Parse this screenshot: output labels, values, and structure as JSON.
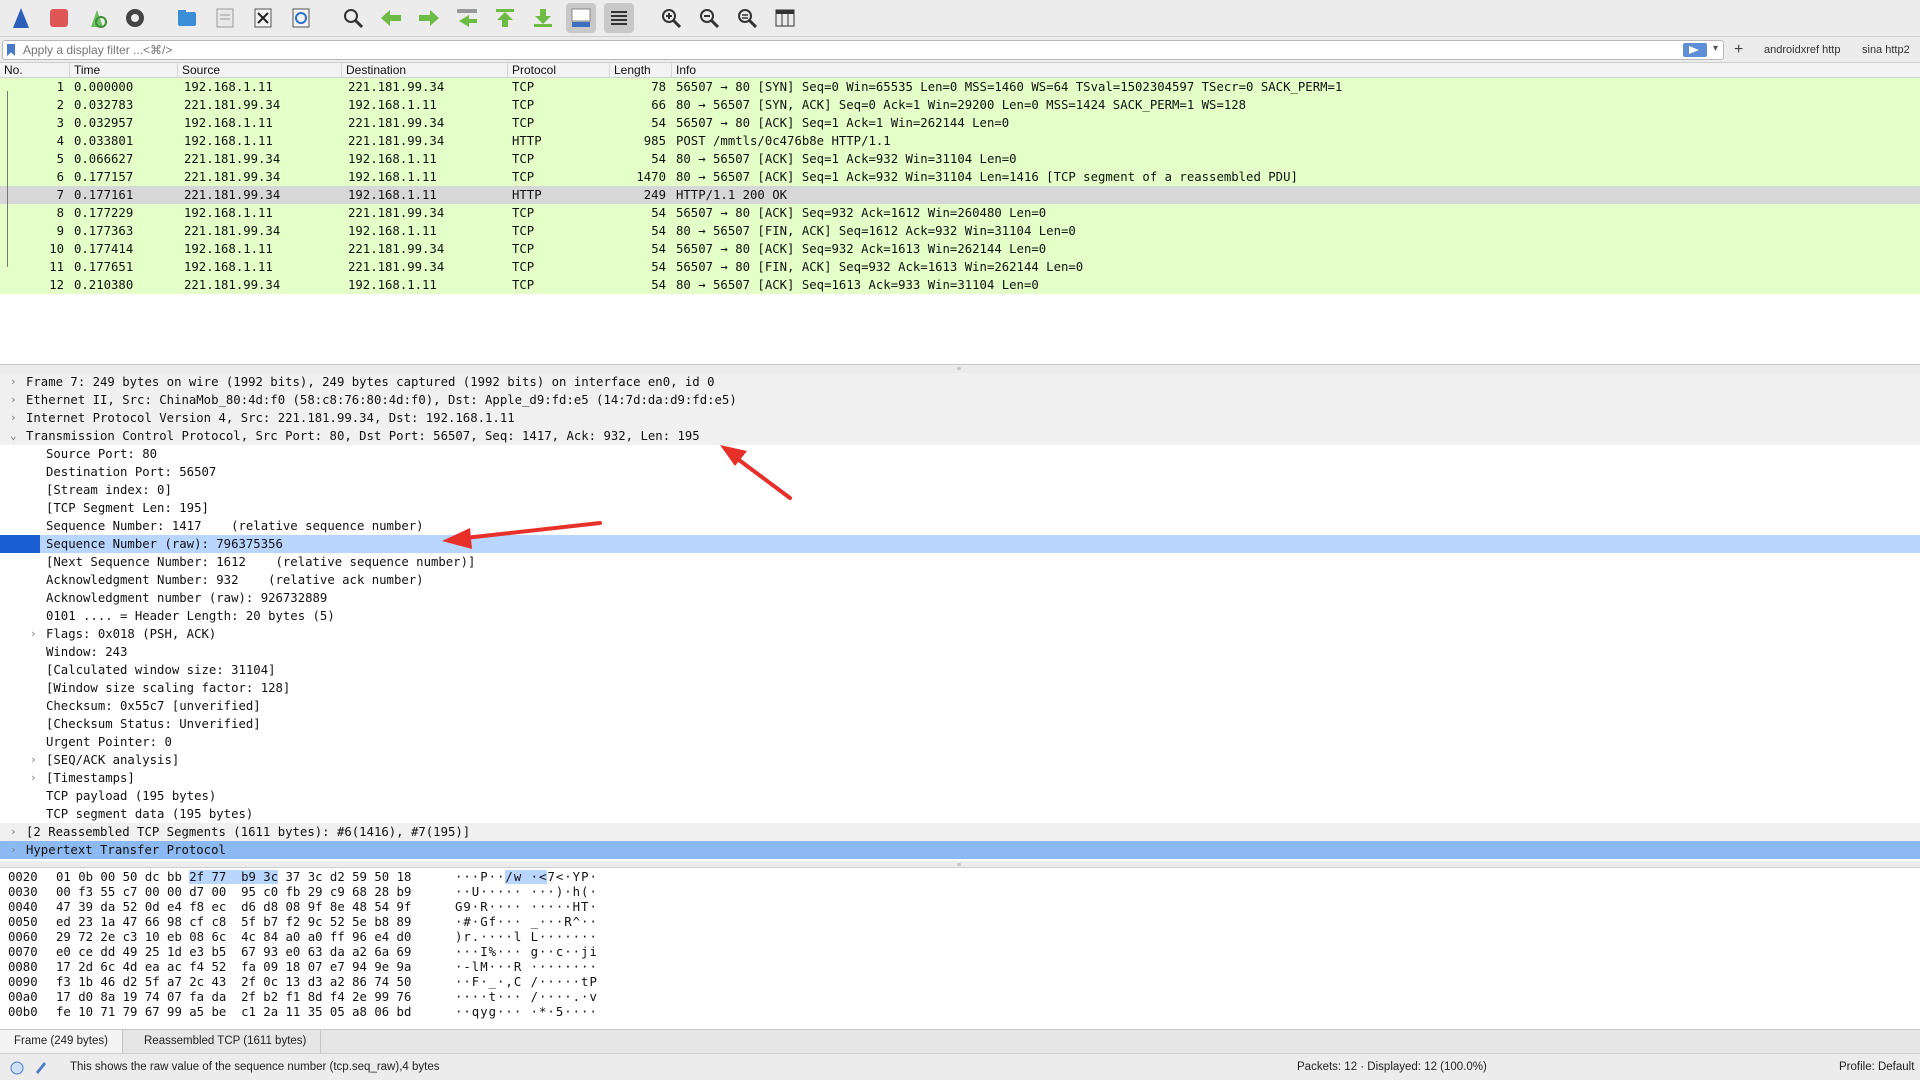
{
  "toolbar": {
    "buttons": [
      "shark-fin-start-icon",
      "stop-capture-icon",
      "restart-capture-icon",
      "capture-options-icon",
      "open-file-icon",
      "save-file-icon",
      "close-file-icon",
      "reload-file-icon",
      "find-packet-icon",
      "go-back-icon",
      "go-forward-icon",
      "go-to-packet-icon",
      "first-packet-icon",
      "last-packet-icon",
      "autoscroll-icon",
      "colorize-icon",
      "zoom-in-icon",
      "zoom-out-icon",
      "zoom-normal-icon",
      "resize-columns-icon"
    ]
  },
  "filter": {
    "placeholder": "Apply a display filter ...<⌘/>",
    "add_label": "+",
    "buttons": [
      "androidxref http",
      "sina http2"
    ]
  },
  "packet_list": {
    "columns": [
      "No.",
      "Time",
      "Source",
      "Destination",
      "Protocol",
      "Length",
      "Info"
    ],
    "rows": [
      {
        "no": "1",
        "time": "0.000000",
        "src": "192.168.1.11",
        "dst": "221.181.99.34",
        "proto": "TCP",
        "len": "78",
        "info": "56507 → 80 [SYN] Seq=0 Win=65535 Len=0 MSS=1460 WS=64 TSval=1502304597 TSecr=0 SACK_PERM=1"
      },
      {
        "no": "2",
        "time": "0.032783",
        "src": "221.181.99.34",
        "dst": "192.168.1.11",
        "proto": "TCP",
        "len": "66",
        "info": "80 → 56507 [SYN, ACK] Seq=0 Ack=1 Win=29200 Len=0 MSS=1424 SACK_PERM=1 WS=128"
      },
      {
        "no": "3",
        "time": "0.032957",
        "src": "192.168.1.11",
        "dst": "221.181.99.34",
        "proto": "TCP",
        "len": "54",
        "info": "56507 → 80 [ACK] Seq=1 Ack=1 Win=262144 Len=0"
      },
      {
        "no": "4",
        "time": "0.033801",
        "src": "192.168.1.11",
        "dst": "221.181.99.34",
        "proto": "HTTP",
        "len": "985",
        "info": "POST /mmtls/0c476b8e HTTP/1.1"
      },
      {
        "no": "5",
        "time": "0.066627",
        "src": "221.181.99.34",
        "dst": "192.168.1.11",
        "proto": "TCP",
        "len": "54",
        "info": "80 → 56507 [ACK] Seq=1 Ack=932 Win=31104 Len=0"
      },
      {
        "no": "6",
        "time": "0.177157",
        "src": "221.181.99.34",
        "dst": "192.168.1.11",
        "proto": "TCP",
        "len": "1470",
        "info": "80 → 56507 [ACK] Seq=1 Ack=932 Win=31104 Len=1416 [TCP segment of a reassembled PDU]"
      },
      {
        "no": "7",
        "time": "0.177161",
        "src": "221.181.99.34",
        "dst": "192.168.1.11",
        "proto": "HTTP",
        "len": "249",
        "info": "HTTP/1.1 200 OK"
      },
      {
        "no": "8",
        "time": "0.177229",
        "src": "192.168.1.11",
        "dst": "221.181.99.34",
        "proto": "TCP",
        "len": "54",
        "info": "56507 → 80 [ACK] Seq=932 Ack=1612 Win=260480 Len=0"
      },
      {
        "no": "9",
        "time": "0.177363",
        "src": "221.181.99.34",
        "dst": "192.168.1.11",
        "proto": "TCP",
        "len": "54",
        "info": "80 → 56507 [FIN, ACK] Seq=1612 Ack=932 Win=31104 Len=0"
      },
      {
        "no": "10",
        "time": "0.177414",
        "src": "192.168.1.11",
        "dst": "221.181.99.34",
        "proto": "TCP",
        "len": "54",
        "info": "56507 → 80 [ACK] Seq=932 Ack=1613 Win=262144 Len=0"
      },
      {
        "no": "11",
        "time": "0.177651",
        "src": "192.168.1.11",
        "dst": "221.181.99.34",
        "proto": "TCP",
        "len": "54",
        "info": "56507 → 80 [FIN, ACK] Seq=932 Ack=1613 Win=262144 Len=0"
      },
      {
        "no": "12",
        "time": "0.210380",
        "src": "221.181.99.34",
        "dst": "192.168.1.11",
        "proto": "TCP",
        "len": "54",
        "info": "80 → 56507 [ACK] Seq=1613 Ack=933 Win=31104 Len=0"
      }
    ],
    "row_colors": {
      "tcp_http": "#e4ffc7",
      "selected": "#d7d7d7"
    }
  },
  "details": {
    "lines": [
      {
        "text": "Frame 7: 249 bytes on wire (1992 bits), 249 bytes captured (1992 bits) on interface en0, id 0",
        "chev": "›"
      },
      {
        "text": "Ethernet II, Src: ChinaMob_80:4d:f0 (58:c8:76:80:4d:f0), Dst: Apple_d9:fd:e5 (14:7d:da:d9:fd:e5)",
        "chev": "›"
      },
      {
        "text": "Internet Protocol Version 4, Src: 221.181.99.34, Dst: 192.168.1.11",
        "chev": "›"
      },
      {
        "text": "Transmission Control Protocol, Src Port: 80, Dst Port: 56507, Seq: 1417, Ack: 932, Len: 195",
        "chev": "⌄"
      },
      {
        "text": "Source Port: 80"
      },
      {
        "text": "Destination Port: 56507"
      },
      {
        "text": "[Stream index: 0]"
      },
      {
        "text": "[TCP Segment Len: 195]"
      },
      {
        "text": "Sequence Number: 1417    (relative sequence number)"
      },
      {
        "text": "Sequence Number (raw): 796375356"
      },
      {
        "text": "[Next Sequence Number: 1612    (relative sequence number)]"
      },
      {
        "text": "Acknowledgment Number: 932    (relative ack number)"
      },
      {
        "text": "Acknowledgment number (raw): 926732889"
      },
      {
        "text": "0101 .... = Header Length: 20 bytes (5)"
      },
      {
        "text": "Flags: 0x018 (PSH, ACK)",
        "chev": "›"
      },
      {
        "text": "Window: 243"
      },
      {
        "text": "[Calculated window size: 31104]"
      },
      {
        "text": "[Window size scaling factor: 128]"
      },
      {
        "text": "Checksum: 0x55c7 [unverified]"
      },
      {
        "text": "[Checksum Status: Unverified]"
      },
      {
        "text": "Urgent Pointer: 0"
      },
      {
        "text": "[SEQ/ACK analysis]",
        "chev": "›"
      },
      {
        "text": "[Timestamps]",
        "chev": "›"
      },
      {
        "text": "TCP payload (195 bytes)"
      },
      {
        "text": "TCP segment data (195 bytes)"
      },
      {
        "text": "[2 Reassembled TCP Segments (1611 bytes): #6(1416), #7(195)]",
        "chev": "›"
      },
      {
        "text": "Hypertext Transfer Protocol",
        "chev": "›"
      }
    ]
  },
  "bytes": {
    "rows": [
      {
        "ofs": "0020",
        "hex_a": "01 0b 00 50 dc bb ",
        "hex_hl": "2f 77  b9 3c",
        "hex_b": " 37 3c d2 59 50 18",
        "asc_a": "···P··",
        "asc_hl": "/w ·<",
        "asc_b": "7<·YP·"
      },
      {
        "ofs": "0030",
        "hex": "00 f3 55 c7 00 00 d7 00  95 c0 fb 29 c9 68 28 b9",
        "asc": "··U····· ···)·h(·"
      },
      {
        "ofs": "0040",
        "hex": "47 39 da 52 0d e4 f8 ec  d6 d8 08 9f 8e 48 54 9f",
        "asc": "G9·R···· ·····HT·"
      },
      {
        "ofs": "0050",
        "hex": "ed 23 1a 47 66 98 cf c8  5f b7 f2 9c 52 5e b8 89",
        "asc": "·#·Gf··· _···R^··"
      },
      {
        "ofs": "0060",
        "hex": "29 72 2e c3 10 eb 08 6c  4c 84 a0 a0 ff 96 e4 d0",
        "asc": ")r.····l L·······"
      },
      {
        "ofs": "0070",
        "hex": "e0 ce dd 49 25 1d e3 b5  67 93 e0 63 da a2 6a 69",
        "asc": "···I%··· g··c··ji"
      },
      {
        "ofs": "0080",
        "hex": "17 2d 6c 4d ea ac f4 52  fa 09 18 07 e7 94 9e 9a",
        "asc": "·-lM···R ········"
      },
      {
        "ofs": "0090",
        "hex": "f3 1b 46 d2 5f a7 2c 43  2f 0c 13 d3 a2 86 74 50",
        "asc": "··F·_·,C /·····tP"
      },
      {
        "ofs": "00a0",
        "hex": "17 d0 8a 19 74 07 fa da  2f b2 f1 8d f4 2e 99 76",
        "asc": "····t··· /····.·v"
      },
      {
        "ofs": "00b0",
        "hex": "fe 10 71 79 67 99 a5 be  c1 2a 11 35 05 a8 06 bd",
        "asc": "··qyg··· ·*·5····"
      }
    ]
  },
  "bottom_tabs": [
    "Frame (249 bytes)",
    "Reassembled TCP (1611 bytes)"
  ],
  "status": {
    "message": "This shows the raw value of the sequence number (tcp.seq_raw),4 bytes",
    "packets": "Packets: 12 · Displayed: 12 (100.0%)",
    "profile": "Profile: Default"
  },
  "colors": {
    "accent": "#1b5fd4",
    "selection_light": "#b8d6ff",
    "annotation_arrow": "#e8302a"
  }
}
